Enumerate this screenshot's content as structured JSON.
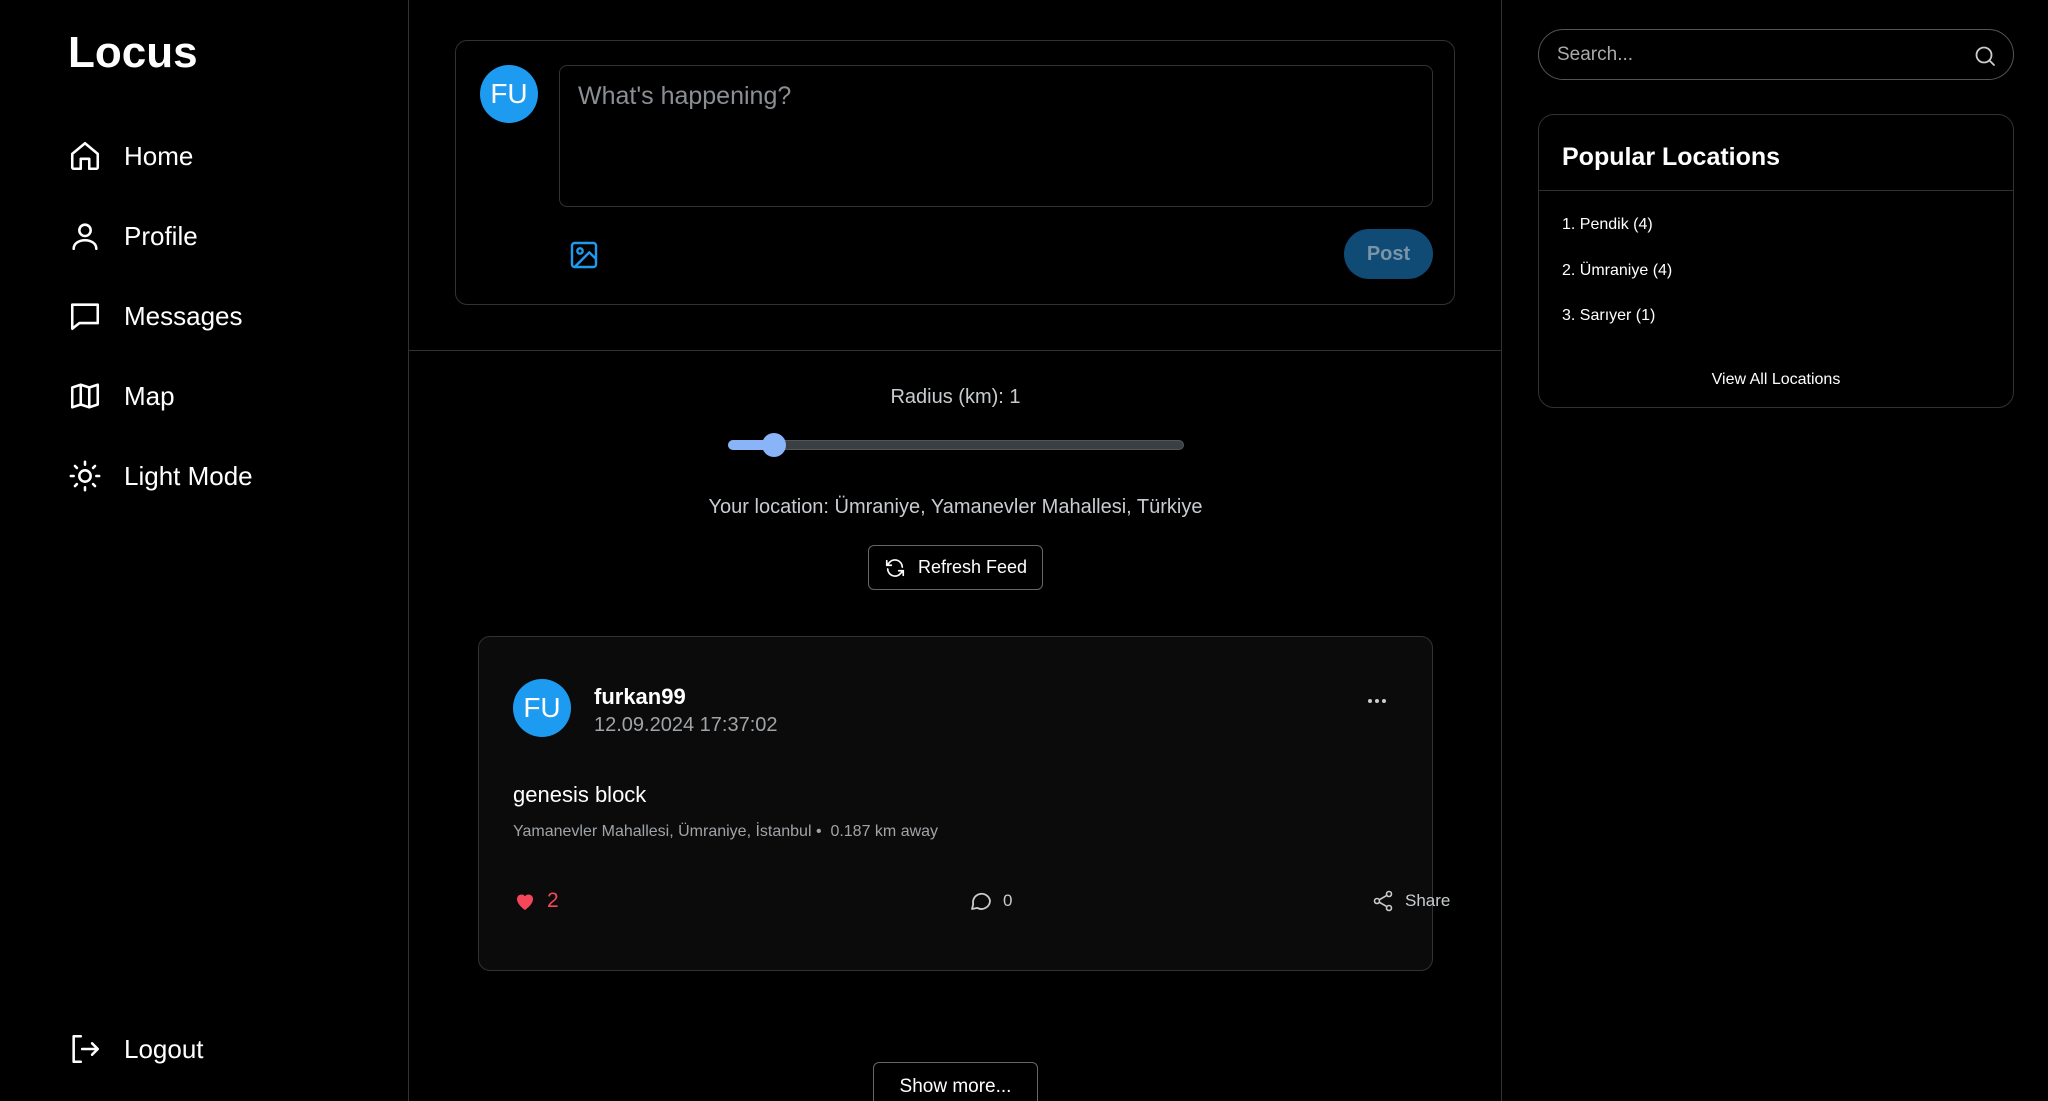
{
  "app": {
    "logo": "Locus"
  },
  "nav": {
    "home": "Home",
    "profile": "Profile",
    "messages": "Messages",
    "map": "Map",
    "light_mode": "Light Mode",
    "logout": "Logout"
  },
  "composer": {
    "avatar_initials": "FU",
    "placeholder": "What's happening?",
    "post_label": "Post"
  },
  "feed_controls": {
    "radius_label": "Radius (km): 1",
    "radius_value": 1,
    "location_text": "Your location: Ümraniye, Yamanevler Mahallesi, Türkiye",
    "refresh_label": "Refresh Feed"
  },
  "posts": [
    {
      "avatar_initials": "FU",
      "username": "furkan99",
      "timestamp": "12.09.2024 17:37:02",
      "text": "genesis block",
      "place": "Yamanevler Mahallesi, Ümraniye, İstanbul •",
      "distance": "0.187 km away",
      "likes": "2",
      "comments": "0",
      "share_label": "Share"
    }
  ],
  "show_more_label": "Show more...",
  "search": {
    "placeholder": "Search..."
  },
  "popular": {
    "title": "Popular Locations",
    "items": [
      "1. Pendik (4)",
      "2. Ümraniye (4)",
      "3. Sarıyer (1)"
    ],
    "view_all": "View All Locations"
  },
  "colors": {
    "accent": "#1d9bf0",
    "like": "#f4475a",
    "slider": "#8ab4f8",
    "post_button": "#0f4b74"
  }
}
